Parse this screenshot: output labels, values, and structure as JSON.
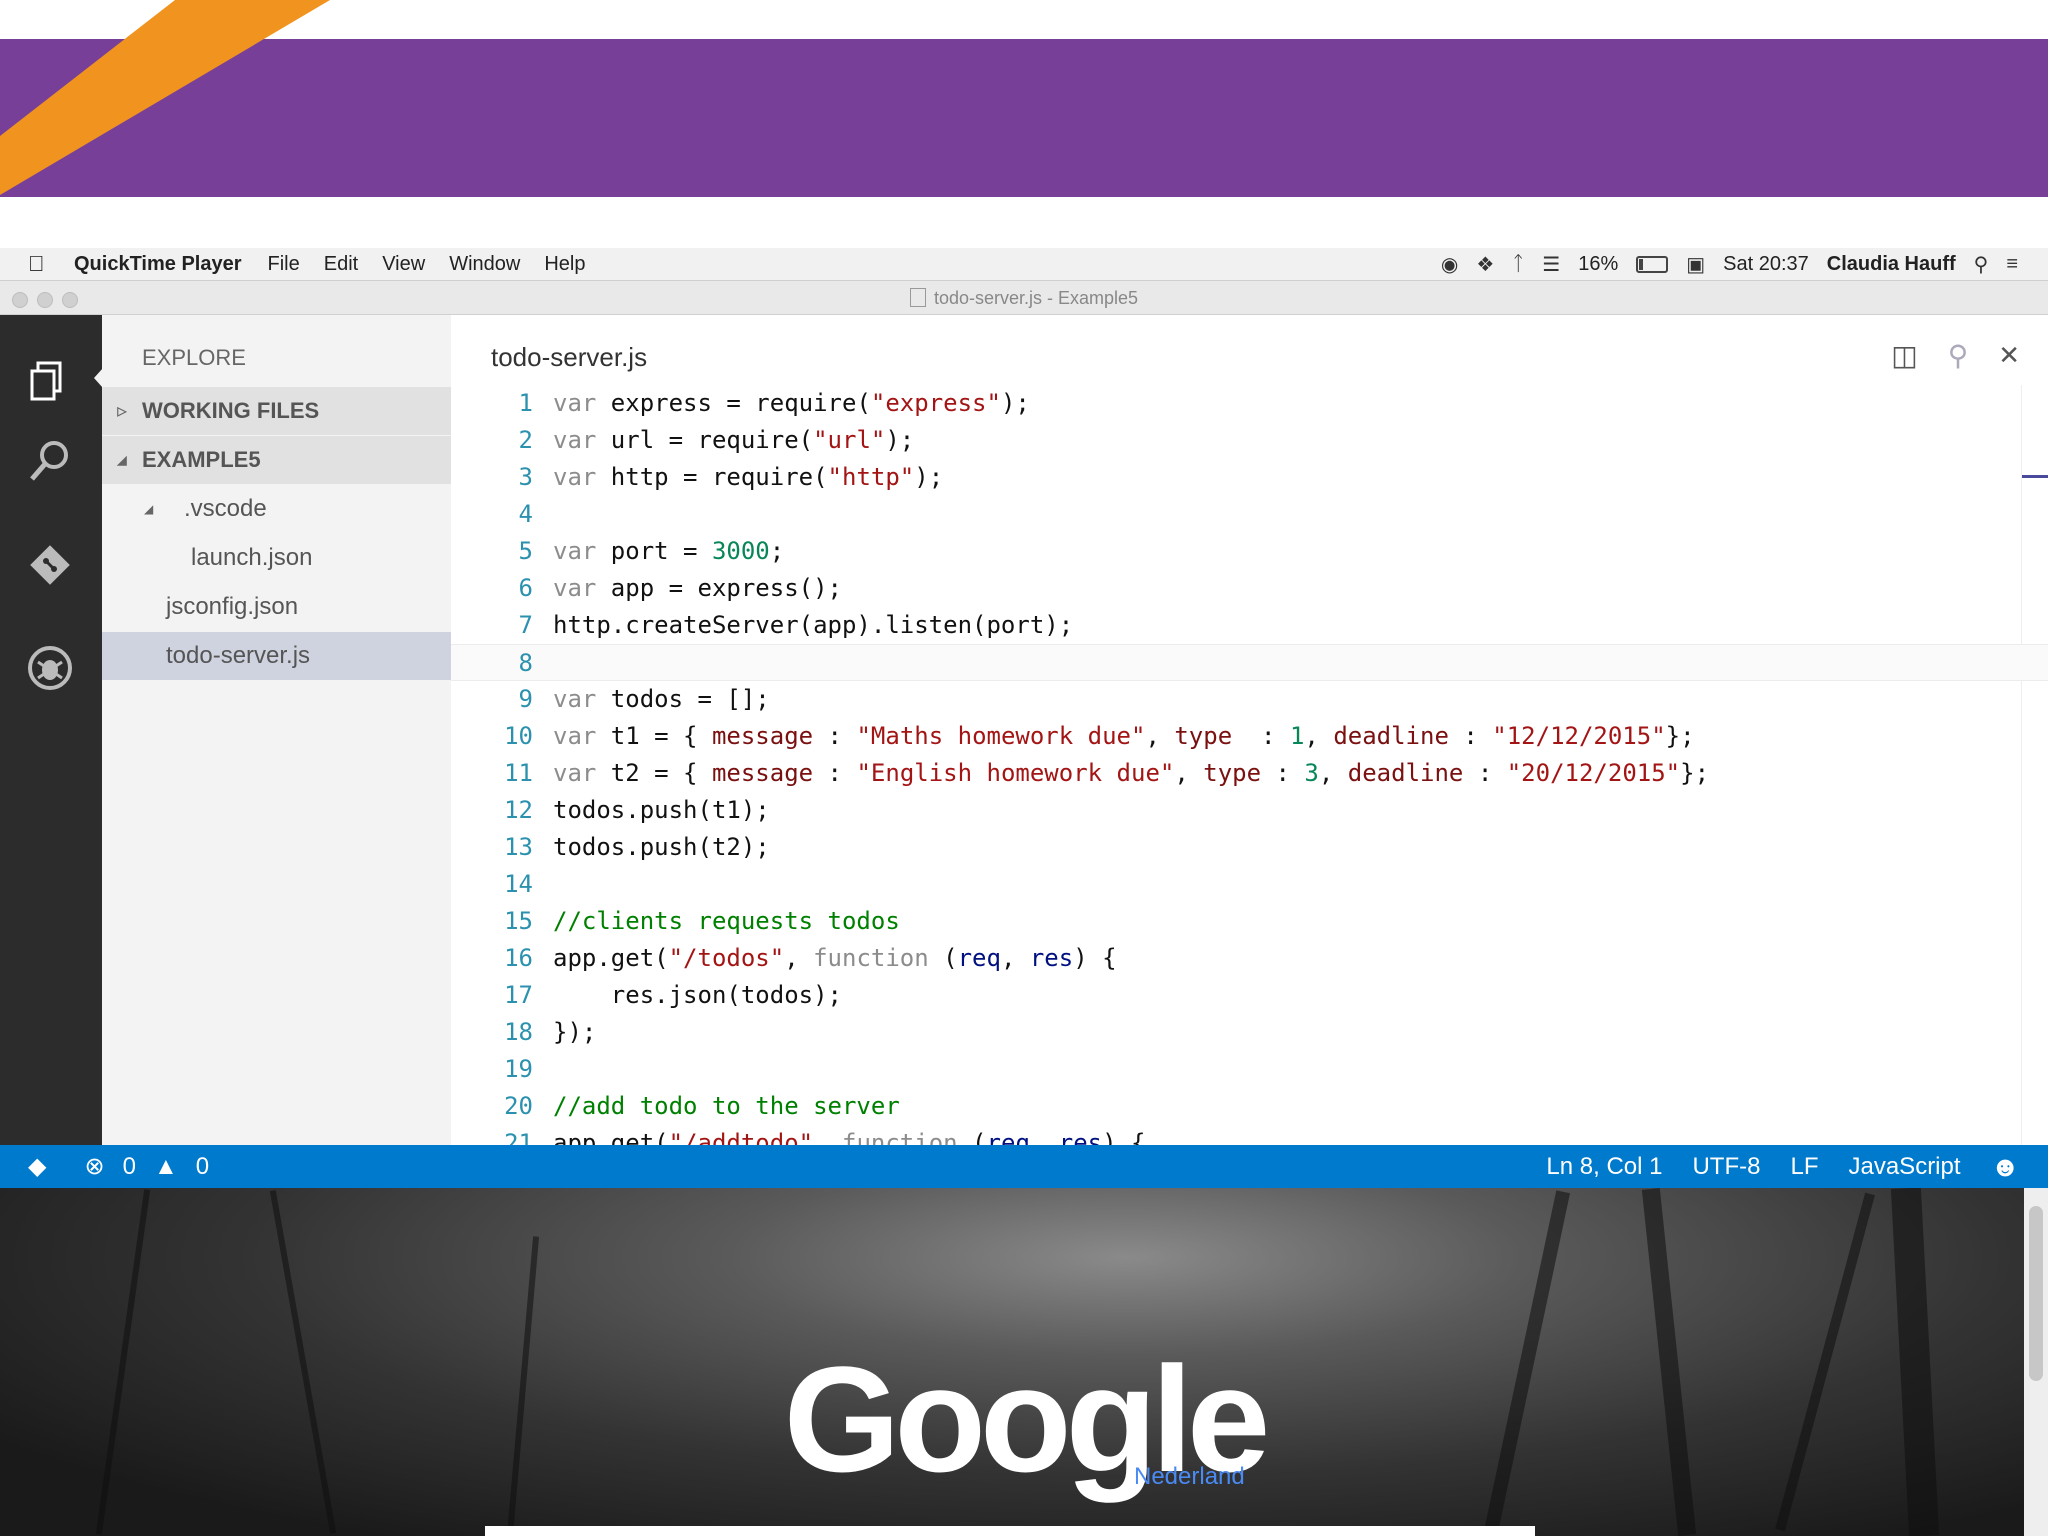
{
  "colors": {
    "slide_band": "#773f98",
    "slide_stripe": "#f0941f",
    "activity_bar": "#2c2c2c",
    "statusbar": "#007acc",
    "selected_item": "#cfd3e0"
  },
  "menubar": {
    "app_name": "QuickTime Player",
    "items": [
      "File",
      "Edit",
      "View",
      "Window",
      "Help"
    ],
    "battery": "16%",
    "clock": "Sat 20:37",
    "user": "Claudia Hauff"
  },
  "window": {
    "title": "todo-server.js - Example5"
  },
  "sidebar": {
    "header": "EXPLORE",
    "sections": [
      "WORKING FILES",
      "EXAMPLE5"
    ],
    "tree": [
      ".vscode",
      "launch.json",
      "jsconfig.json",
      "todo-server.js"
    ]
  },
  "editor": {
    "tab_title": "todo-server.js",
    "line_numbers": [
      "1",
      "2",
      "3",
      "4",
      "5",
      "6",
      "7",
      "8",
      "9",
      "10",
      "11",
      "12",
      "13",
      "14",
      "15",
      "16",
      "17",
      "18",
      "19",
      "20",
      "21"
    ]
  },
  "statusbar": {
    "errors": "0",
    "warnings": "0",
    "position": "Ln 8, Col 1",
    "encoding": "UTF-8",
    "eol": "LF",
    "language": "JavaScript"
  },
  "browser": {
    "logo_text": "Google",
    "region": "Nederland"
  }
}
